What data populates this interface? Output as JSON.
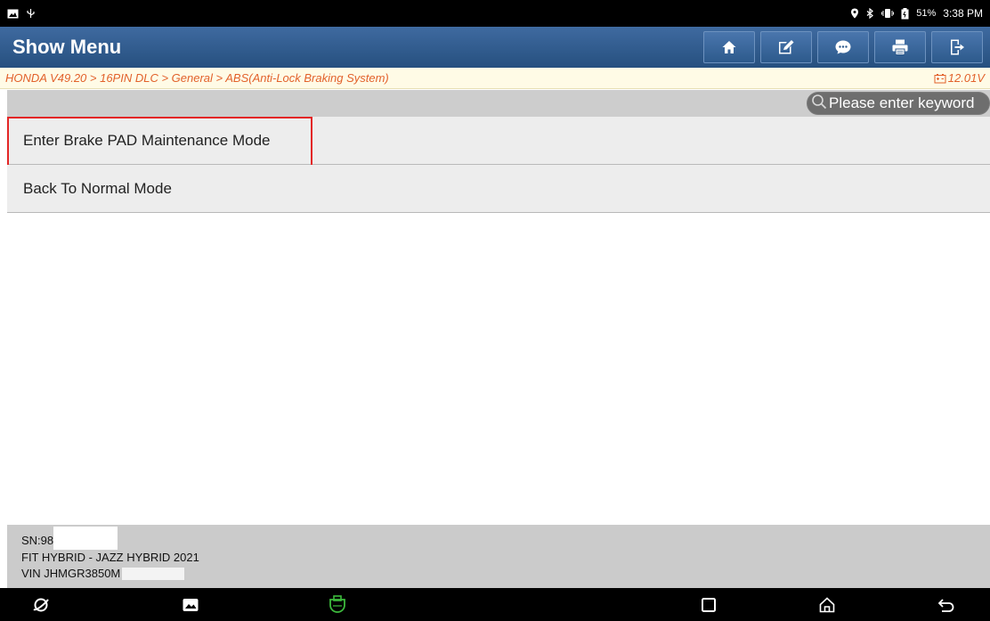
{
  "status_bar": {
    "battery_percent": "51%",
    "time": "3:38 PM",
    "icons": [
      "image-icon",
      "usb-icon",
      "location-icon",
      "bluetooth-icon",
      "vibrate-icon",
      "battery-icon"
    ]
  },
  "header": {
    "title": "Show Menu",
    "toolbar": [
      "home-icon",
      "edit-icon",
      "message-icon",
      "print-icon",
      "exit-icon"
    ]
  },
  "breadcrumb": {
    "path": "HONDA V49.20 > 16PIN DLC > General > ABS(Anti-Lock Braking System)",
    "voltage": "12.01V"
  },
  "search": {
    "placeholder": "Please enter keyword"
  },
  "menu": {
    "items": [
      {
        "label": "Enter Brake PAD Maintenance Mode",
        "selected": true
      },
      {
        "label": "Back To Normal Mode",
        "selected": false
      }
    ]
  },
  "vehicle": {
    "sn": "SN:98",
    "model": "FIT HYBRID - JAZZ HYBRID 2021",
    "vin": "VIN JHMGR3850M"
  },
  "nav_bar": {
    "icons": [
      "browser-icon",
      "gallery-icon",
      "vci-icon",
      "recents-icon",
      "home-nav-icon",
      "back-icon"
    ]
  },
  "colors": {
    "header_bg": "#2f5b8e",
    "breadcrumb_text": "#e2612b",
    "selection_border": "#e32626",
    "vci_icon": "#3dbb3d"
  }
}
